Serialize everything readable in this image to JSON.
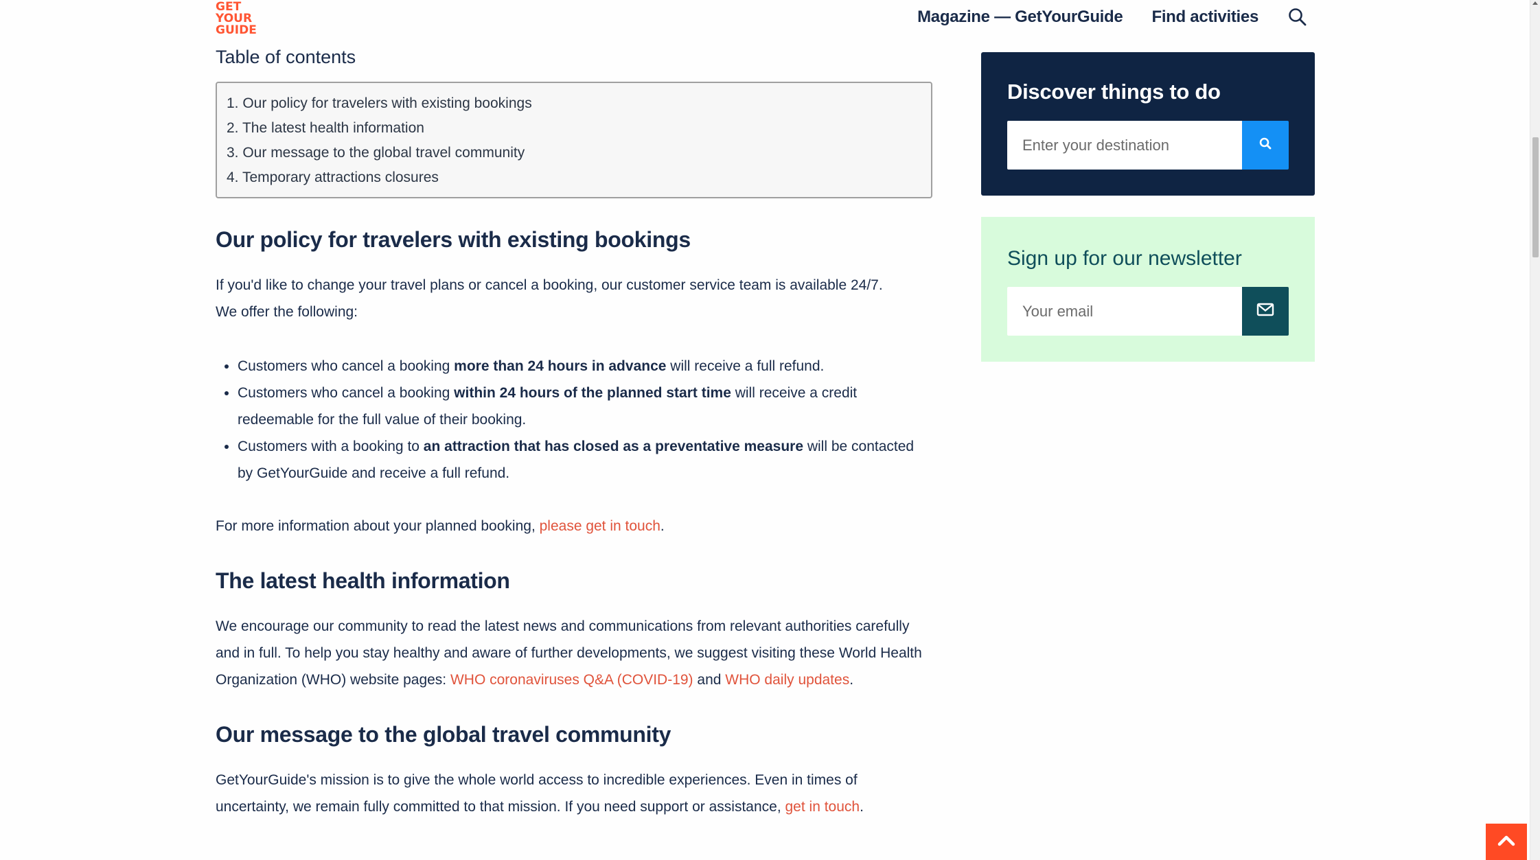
{
  "header": {
    "logo_lines": [
      "GET",
      "YOUR",
      "GUIDE"
    ],
    "nav": [
      {
        "label": "Magazine — GetYourGuide"
      },
      {
        "label": "Find activities"
      }
    ],
    "search_icon": "search-icon"
  },
  "toc": {
    "title": "Table of contents",
    "items": [
      "1. Our policy for travelers with existing bookings",
      "2. The latest health information",
      "3. Our message to the global travel community",
      "4. Temporary attractions closures"
    ]
  },
  "sections": {
    "policy": {
      "heading": "Our policy for travelers with existing bookings",
      "intro_line1": "If you'd like to change your travel plans or cancel a booking, our customer service team is available 24/7.",
      "intro_line2": "We offer the following:",
      "bullets": [
        {
          "pre": "Customers who cancel a booking ",
          "bold": "more than 24 hours in advance",
          "post": " will receive a full refund."
        },
        {
          "pre": "Customers who cancel a booking ",
          "bold": "within 24 hours of the planned start time",
          "post": " will receive a credit redeemable for the full value of their booking."
        },
        {
          "pre": "Customers with a booking to ",
          "bold": "an attraction that has closed as a preventative measure",
          "post": " will be contacted by GetYourGuide and receive a full refund."
        }
      ],
      "more_info_pre": "For more information about your planned booking, ",
      "more_info_link": "please get in touch",
      "more_info_post": "."
    },
    "health": {
      "heading": "The latest health information",
      "text_pre": "We encourage our community to read the latest news and communications from relevant authorities carefully and in full. To help you stay healthy and aware of further developments, we suggest visiting these World Health Organization (WHO) website pages: ",
      "link1": "WHO coronaviruses Q&A (COVID-19)",
      "mid": " and ",
      "link2": "WHO daily updates",
      "post": "."
    },
    "message": {
      "heading": "Our message to the global travel community",
      "text_pre": "GetYourGuide's mission is to give the whole world access to incredible experiences. Even in times of uncertainty, we remain fully committed to that mission. If you need support or assistance, ",
      "link": "get in touch",
      "post": "."
    }
  },
  "sidebar": {
    "discover": {
      "title": "Discover things to do",
      "placeholder": "Enter your destination",
      "value": ""
    },
    "newsletter": {
      "title": "Sign up for our newsletter",
      "placeholder": "Your email",
      "value": ""
    }
  },
  "colors": {
    "brand": "#ff5533",
    "link": "#e0533b",
    "navy": "#0f2443",
    "search_blue": "#1490f5",
    "newsletter_bg": "#d8fbdc",
    "teal": "#0f4e5a"
  }
}
